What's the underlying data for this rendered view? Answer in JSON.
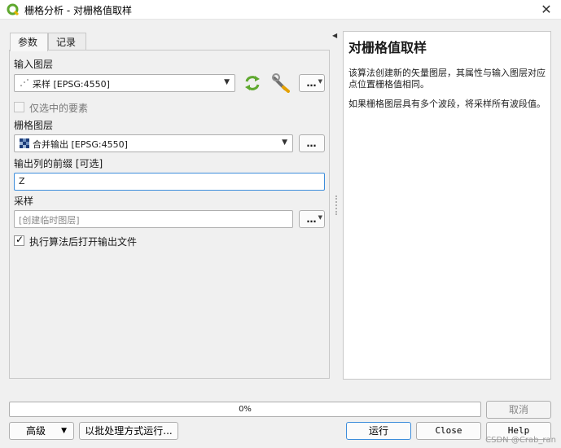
{
  "window": {
    "title": "栅格分析 - 对栅格值取样",
    "close_label": "✕"
  },
  "tabs": [
    {
      "label": "参数"
    },
    {
      "label": "记录"
    }
  ],
  "form": {
    "input_layer_label": "输入图层",
    "input_layer_value": "采样 [EPSG:4550]",
    "selected_only_label": "仅选中的要素",
    "raster_layer_label": "栅格图层",
    "raster_layer_value": "合并输出 [EPSG:4550]",
    "prefix_label": "输出列的前缀 [可选]",
    "prefix_value": "Z",
    "sample_label": "采样",
    "sample_placeholder": "[创建临时图层]",
    "open_output_label": "执行算法后打开输出文件",
    "ellipsis": "…"
  },
  "help": {
    "title": "对栅格值取样",
    "para1": "该算法创建新的矢量图层，其属性与输入图层对应点位置栅格值相同。",
    "para2": "如果栅格图层具有多个波段，将采样所有波段值。"
  },
  "progress": {
    "value": 0,
    "label": "0%"
  },
  "buttons": {
    "cancel": "取消",
    "advanced": "高级",
    "batch": "以批处理方式运行...",
    "run": "运行",
    "close": "Close",
    "help": "Help"
  },
  "watermark": "CSDN @Crab_ran",
  "colors": {
    "accent": "#3d8ddb",
    "qgis_green": "#5fa82f"
  }
}
